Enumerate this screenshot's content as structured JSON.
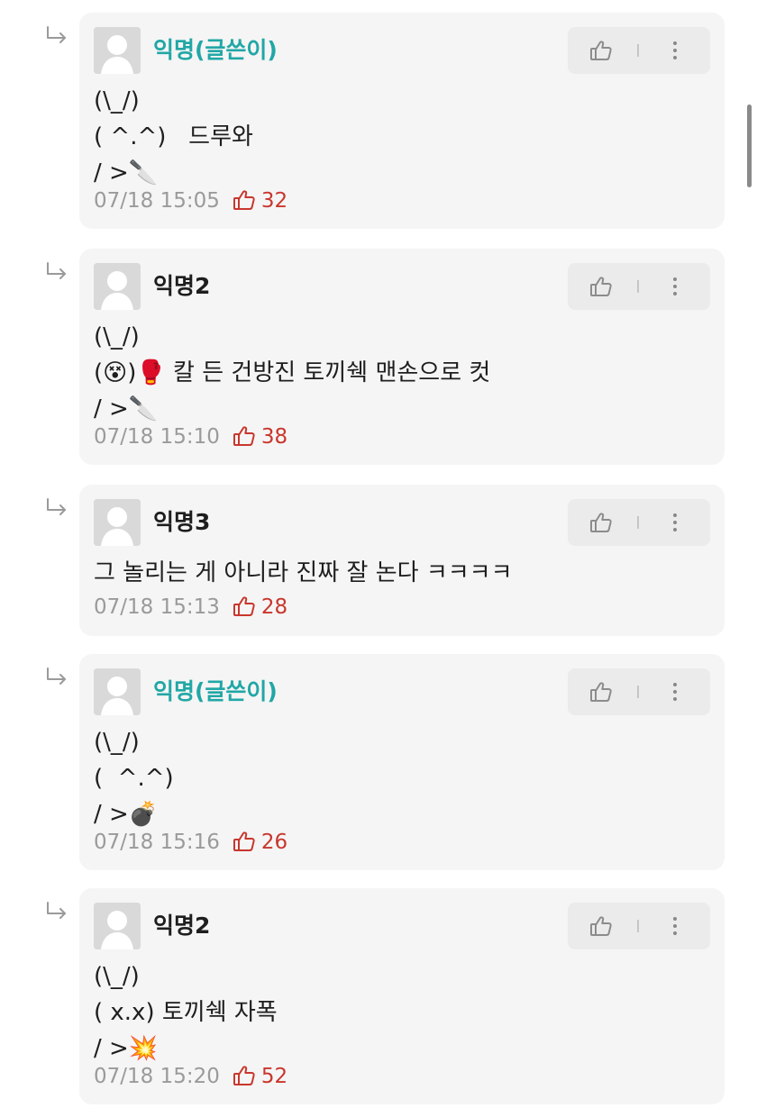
{
  "comments": [
    {
      "author": "익명(글쓴이)",
      "is_op": true,
      "lines": [
        "(\\_/)",
        "( ^.^)   드루와",
        "/ >🔪"
      ],
      "time": "07/18 15:05",
      "likes": "32"
    },
    {
      "author": "익명2",
      "is_op": false,
      "lines": [
        "(\\_/)",
        "(😵)🥊 칼 든 건방진 토끼쉑 맨손으로 컷",
        "/ >🔪"
      ],
      "time": "07/18 15:10",
      "likes": "38"
    },
    {
      "author": "익명3",
      "is_op": false,
      "lines": [
        "그 놀리는 게 아니라 진짜 잘 논다 ㅋㅋㅋㅋ"
      ],
      "time": "07/18 15:13",
      "likes": "28"
    },
    {
      "author": "익명(글쓴이)",
      "is_op": true,
      "lines": [
        "(\\_/)",
        "(  ^.^)",
        "/ >💣"
      ],
      "time": "07/18 15:16",
      "likes": "26"
    },
    {
      "author": "익명2",
      "is_op": false,
      "lines": [
        "(\\_/)",
        "( x.x) 토끼쉑 자폭",
        "/ >💥"
      ],
      "time": "07/18 15:20",
      "likes": "52"
    }
  ],
  "icons": {
    "reply": "reply-arrow-icon",
    "like": "thumbs-up-icon",
    "more": "more-vertical-icon",
    "avatar": "default-avatar-icon"
  },
  "colors": {
    "op_author": "#21a7a6",
    "like_count": "#c8372d",
    "timestamp": "#9a9a9a",
    "card_bg": "#f5f5f5"
  }
}
